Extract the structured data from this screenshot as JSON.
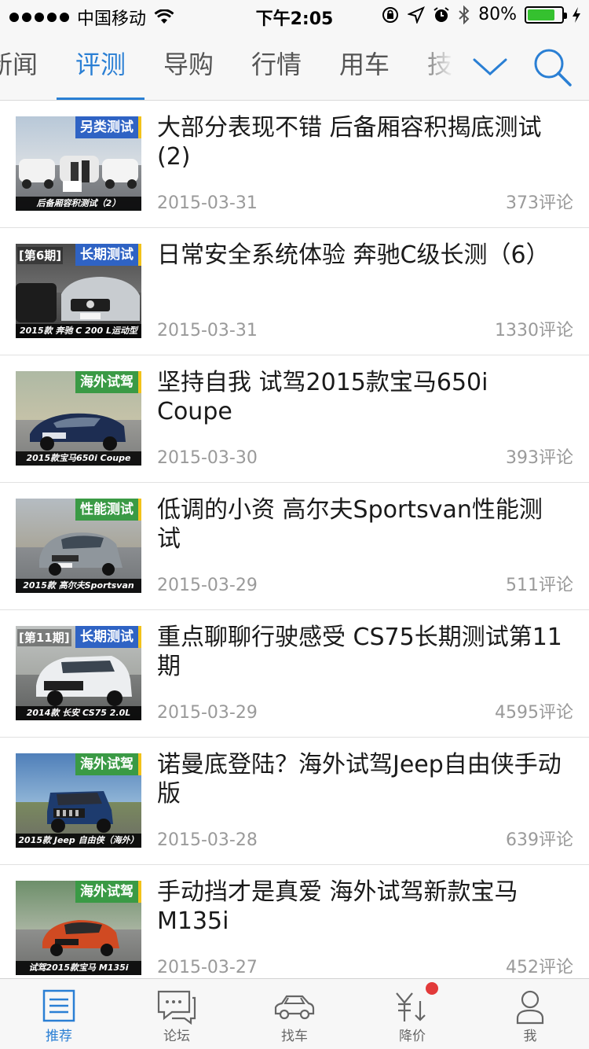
{
  "status_bar": {
    "carrier": "中国移动",
    "time": "下午2:05",
    "battery": "80%",
    "battery_level": 0.8
  },
  "channels": {
    "tabs": [
      {
        "label": "新闻",
        "active": false
      },
      {
        "label": "评测",
        "active": true
      },
      {
        "label": "导购",
        "active": false
      },
      {
        "label": "行情",
        "active": false
      },
      {
        "label": "用车",
        "active": false
      },
      {
        "label": "技术",
        "active": false
      }
    ],
    "expand_icon": "chevron-down-icon",
    "search_icon": "search-icon"
  },
  "articles": [
    {
      "title": "大部分表现不错 后备厢容积揭底测试(2)",
      "date": "2015-03-31",
      "comments": "373评论",
      "tag": "另类测试",
      "tag_color": "#2f63c4",
      "issue": "",
      "caption": "后备厢容积测试（2）"
    },
    {
      "title": "日常安全系统体验 奔驰C级长测（6）",
      "date": "2015-03-31",
      "comments": "1330评论",
      "tag": "长期测试",
      "tag_color": "#2f63c4",
      "issue": "[第6期]",
      "caption": "2015款 奔驰 C 200 L运动型"
    },
    {
      "title": "坚持自我 试驾2015款宝马650i Coupe",
      "date": "2015-03-30",
      "comments": "393评论",
      "tag": "海外试驾",
      "tag_color": "#3a9a45",
      "issue": "",
      "caption": "2015款宝马650i Coupe"
    },
    {
      "title": "低调的小资 高尔夫Sportsvan性能测试",
      "date": "2015-03-29",
      "comments": "511评论",
      "tag": "性能测试",
      "tag_color": "#3a9a45",
      "issue": "",
      "caption": "2015款 高尔夫Sportsvan"
    },
    {
      "title": "重点聊聊行驶感受 CS75长期测试第11期",
      "date": "2015-03-29",
      "comments": "4595评论",
      "tag": "长期测试",
      "tag_color": "#2f63c4",
      "issue": "[第11期]",
      "caption": "2014款 长安 CS75 2.0L"
    },
    {
      "title": "诺曼底登陆？海外试驾Jeep自由侠手动版",
      "date": "2015-03-28",
      "comments": "639评论",
      "tag": "海外试驾",
      "tag_color": "#3a9a45",
      "issue": "",
      "caption": "2015款 Jeep 自由侠（海外）"
    },
    {
      "title": "手动挡才是真爱 海外试驾新款宝马M135i",
      "date": "2015-03-27",
      "comments": "452评论",
      "tag": "海外试驾",
      "tag_color": "#3a9a45",
      "issue": "",
      "caption": "试驾2015款宝马 M135i"
    }
  ],
  "tabbar": [
    {
      "label": "推荐",
      "icon": "recommend-list-icon",
      "active": true
    },
    {
      "label": "论坛",
      "icon": "forum-chat-icon",
      "active": false
    },
    {
      "label": "找车",
      "icon": "car-icon",
      "active": false
    },
    {
      "label": "降价",
      "icon": "price-drop-icon",
      "active": false,
      "badge": true
    },
    {
      "label": "我",
      "icon": "profile-icon",
      "active": false
    }
  ],
  "colors": {
    "accent": "#2a7fd4",
    "battery": "#35c12f",
    "badge": "#e23a3a"
  }
}
